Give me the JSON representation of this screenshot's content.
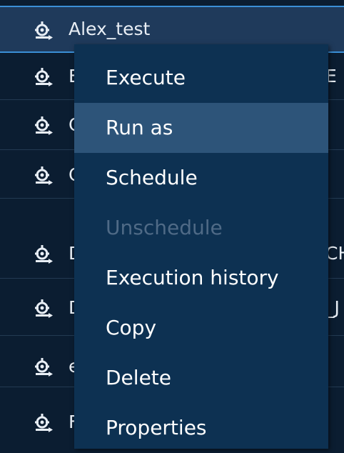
{
  "list": {
    "rows": [
      {
        "label": "Alex_test",
        "tail": ""
      },
      {
        "label": "E",
        "tail": "E"
      },
      {
        "label": "C",
        "tail": ""
      },
      {
        "label": "C",
        "tail": ""
      },
      {
        "label": "D",
        "tail": "CH"
      },
      {
        "label": "D",
        "tail": "_J"
      },
      {
        "label": "e",
        "tail": ""
      },
      {
        "label": "F",
        "tail": ""
      }
    ]
  },
  "context_menu": {
    "items": [
      {
        "label": "Execute",
        "state": "normal"
      },
      {
        "label": "Run as",
        "state": "hover"
      },
      {
        "label": "Schedule",
        "state": "normal"
      },
      {
        "label": "Unschedule",
        "state": "disabled"
      },
      {
        "label": "Execution history",
        "state": "normal"
      },
      {
        "label": "Copy",
        "state": "normal"
      },
      {
        "label": "Delete",
        "state": "normal"
      },
      {
        "label": "Properties",
        "state": "normal"
      }
    ]
  },
  "icons": {
    "job_icon": "job-gear-icon"
  },
  "colors": {
    "background": "#0b1d31",
    "selected_row": "#1f3a5b",
    "selected_border": "#3b8fd6",
    "menu_background": "#0d3152",
    "menu_hover": "#2d5479",
    "disabled_text": "#4f6a86"
  }
}
